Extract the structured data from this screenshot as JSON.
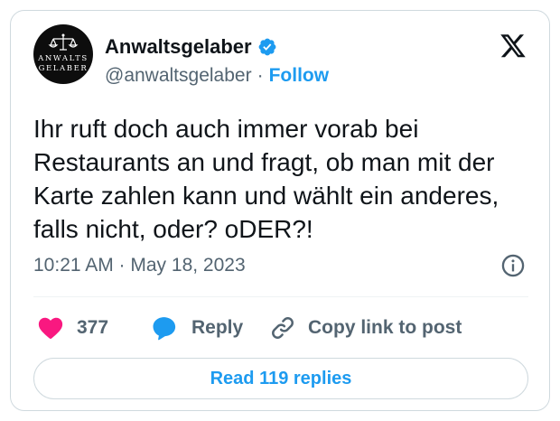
{
  "author": {
    "display_name": "Anwaltsgelaber",
    "handle": "@anwaltsgelaber",
    "separator": "·",
    "follow_label": "Follow",
    "avatar_lines": [
      "ANWALTS",
      "GELABER"
    ]
  },
  "tweet": {
    "text": "Ihr ruft doch auch immer vorab bei Restaurants an und fragt, ob man mit der Karte zahlen kann und wählt ein anderes, falls nicht, oder? oDER?!",
    "timestamp": "10:21 AM · May 18, 2023"
  },
  "actions": {
    "like_count": "377",
    "reply_label": "Reply",
    "copy_label": "Copy link to post"
  },
  "read_replies_label": "Read 119 replies",
  "icons": {
    "verified": "verified-badge-icon",
    "platform": "x-logo-icon",
    "info": "info-icon",
    "like": "heart-icon",
    "reply": "speech-bubble-icon",
    "copy": "link-icon",
    "avatar_emblem": "scales-of-justice-icon"
  },
  "colors": {
    "accent": "#1d9bf0",
    "like": "#f91880",
    "text_primary": "#0f1419",
    "text_secondary": "#536471",
    "border": "#cfd9de"
  }
}
